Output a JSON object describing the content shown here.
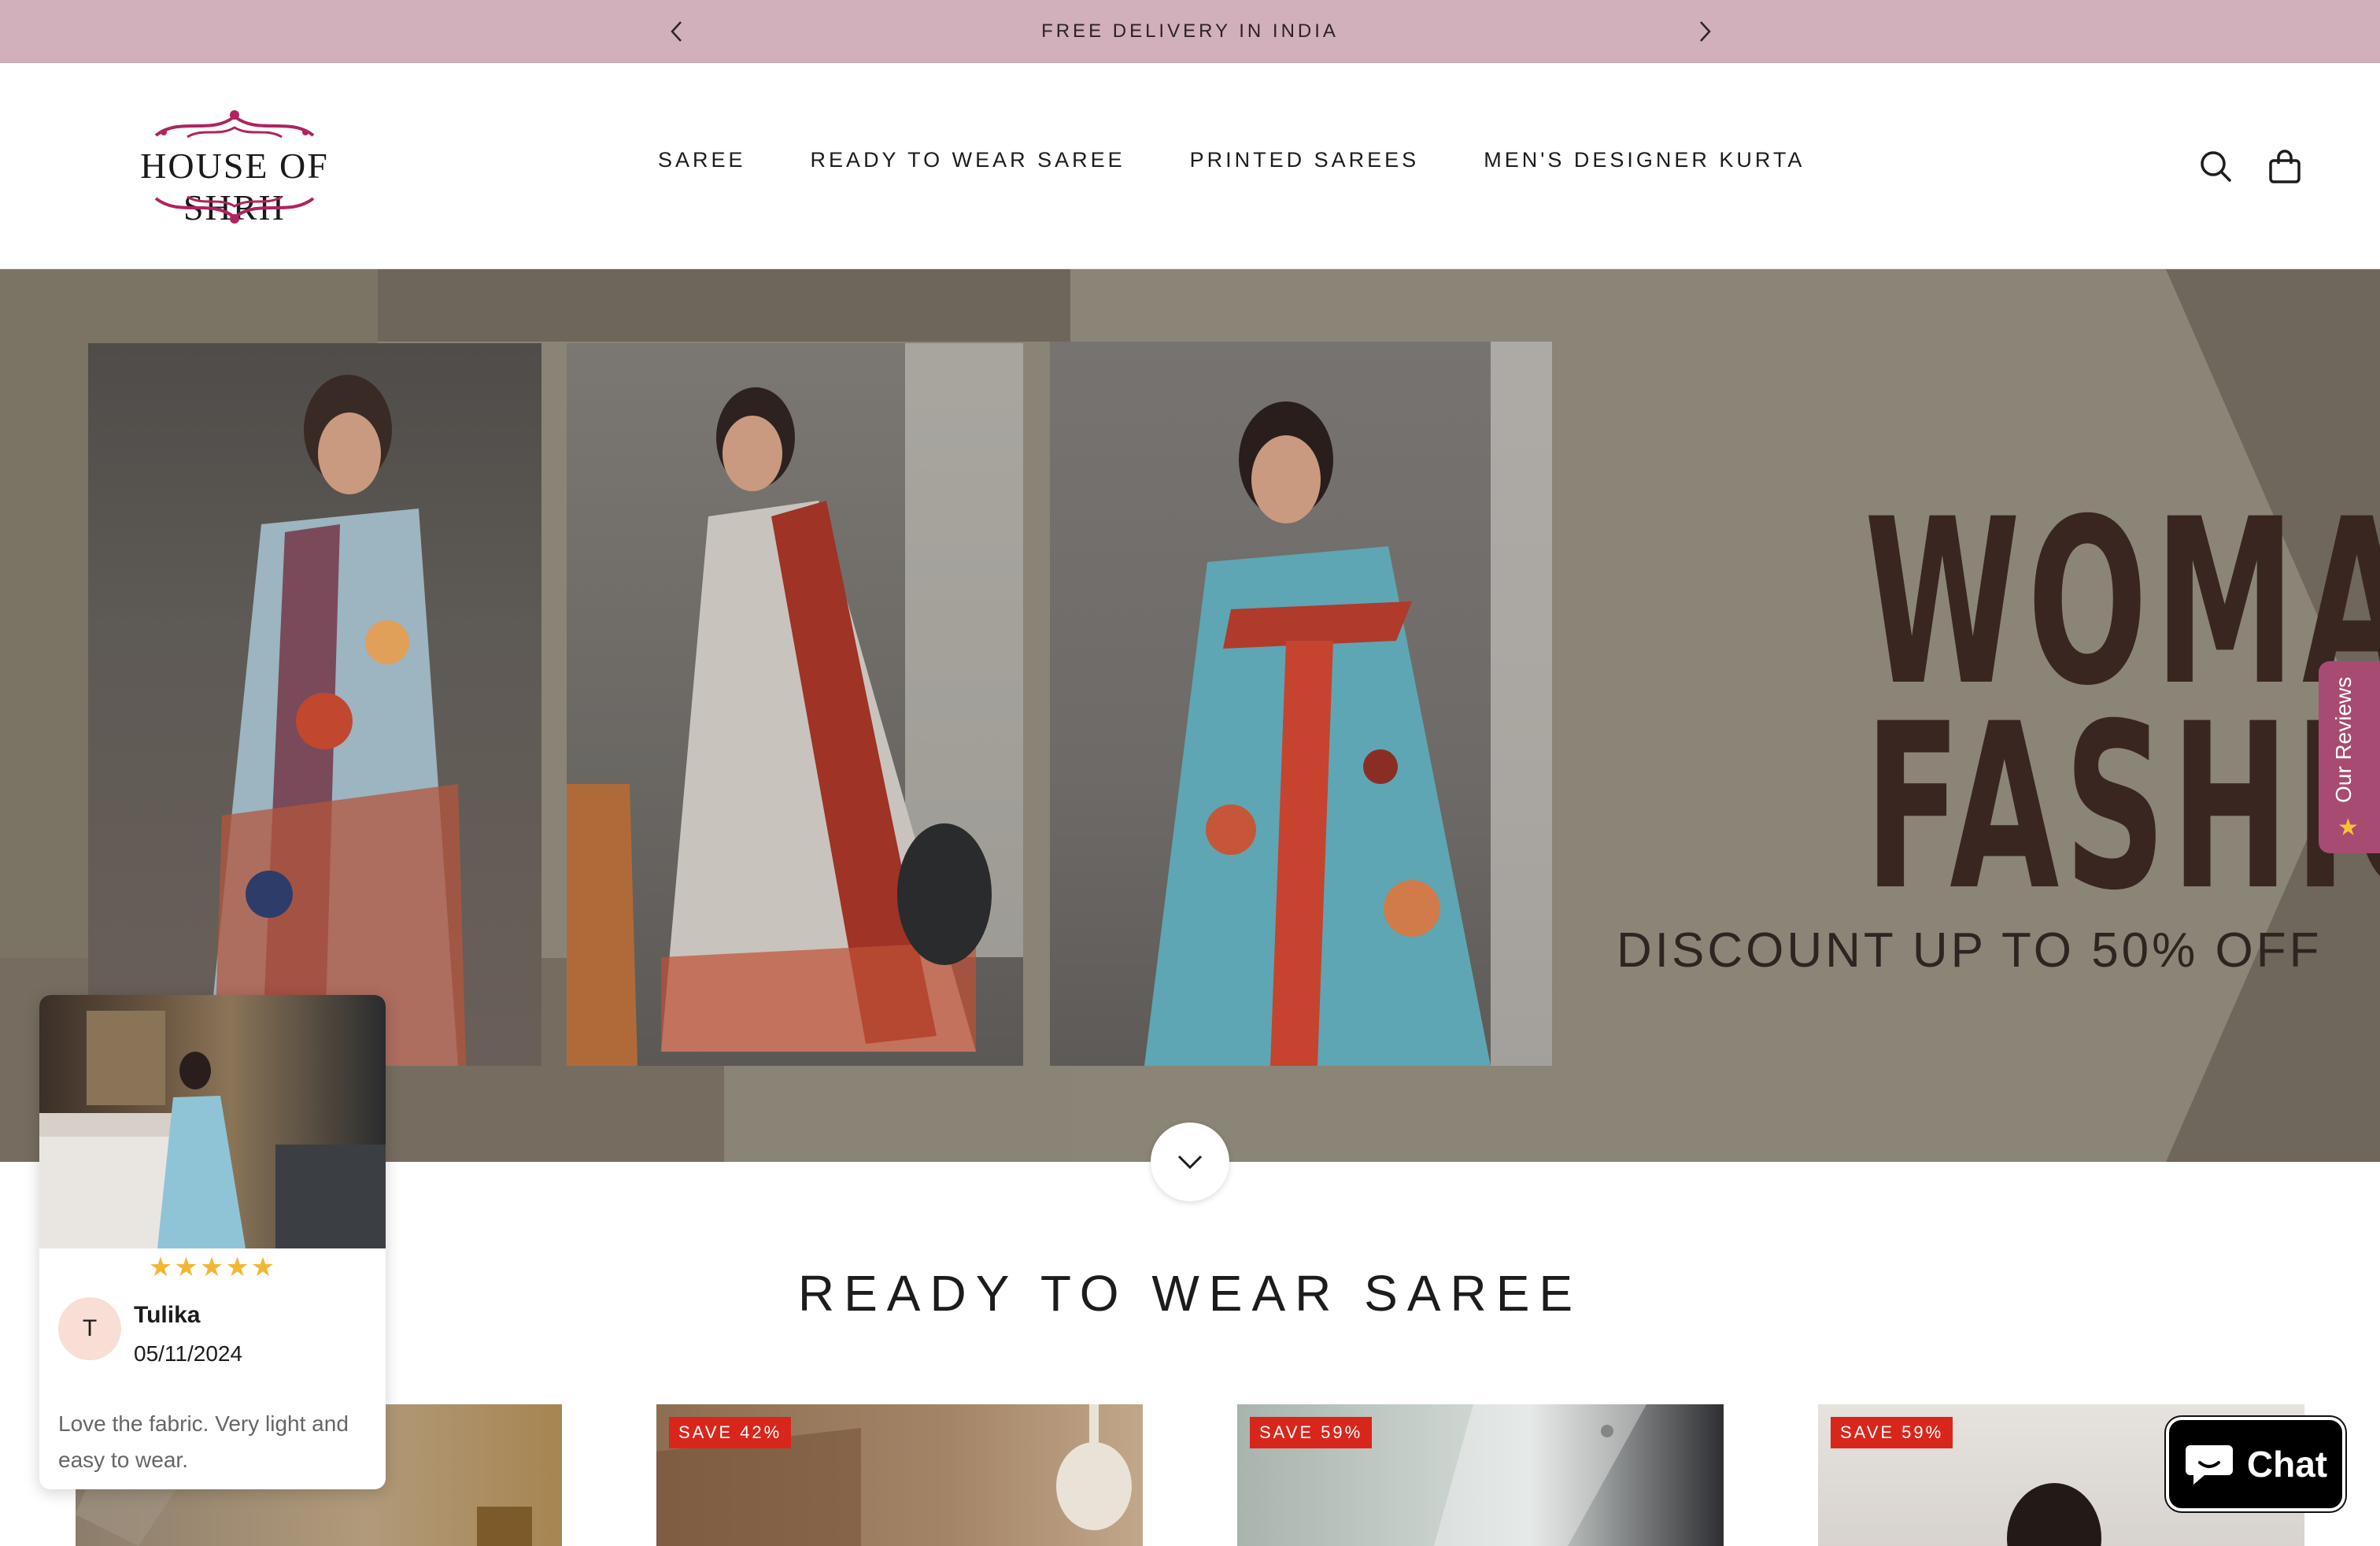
{
  "announcement": {
    "text": "FREE DELIVERY IN INDIA"
  },
  "header": {
    "logo_text": "HOUSE OF SHRII",
    "nav": [
      {
        "label": "SAREE"
      },
      {
        "label": "READY TO WEAR SAREE"
      },
      {
        "label": "PRINTED SAREES"
      },
      {
        "label": "MEN'S DESIGNER KURTA"
      }
    ],
    "icons": [
      "search-icon",
      "shopping-bag-icon"
    ]
  },
  "hero": {
    "title_line1": "WOMAN",
    "title_line2": "FASHION",
    "subtitle": "DISCOUNT UP TO 50% OFF"
  },
  "reviews_tab": {
    "label": "Our Reviews"
  },
  "section": {
    "title": "READY TO WEAR SAREE",
    "products": [
      {
        "badge": ""
      },
      {
        "badge": "SAVE 42%"
      },
      {
        "badge": "SAVE 59%"
      },
      {
        "badge": "SAVE 59%"
      }
    ]
  },
  "review_popup": {
    "stars": "★★★★★",
    "avatar_initial": "T",
    "name": "Tulika",
    "date": "05/11/2024",
    "text": "Love the fabric. Very light and easy to wear."
  },
  "chat": {
    "label": "Chat"
  },
  "colors": {
    "announcement_bg": "#d1afbb",
    "hero_text": "#3a2620",
    "badge_bg": "#d9261c",
    "reviews_tab_bg": "#a84b73"
  }
}
